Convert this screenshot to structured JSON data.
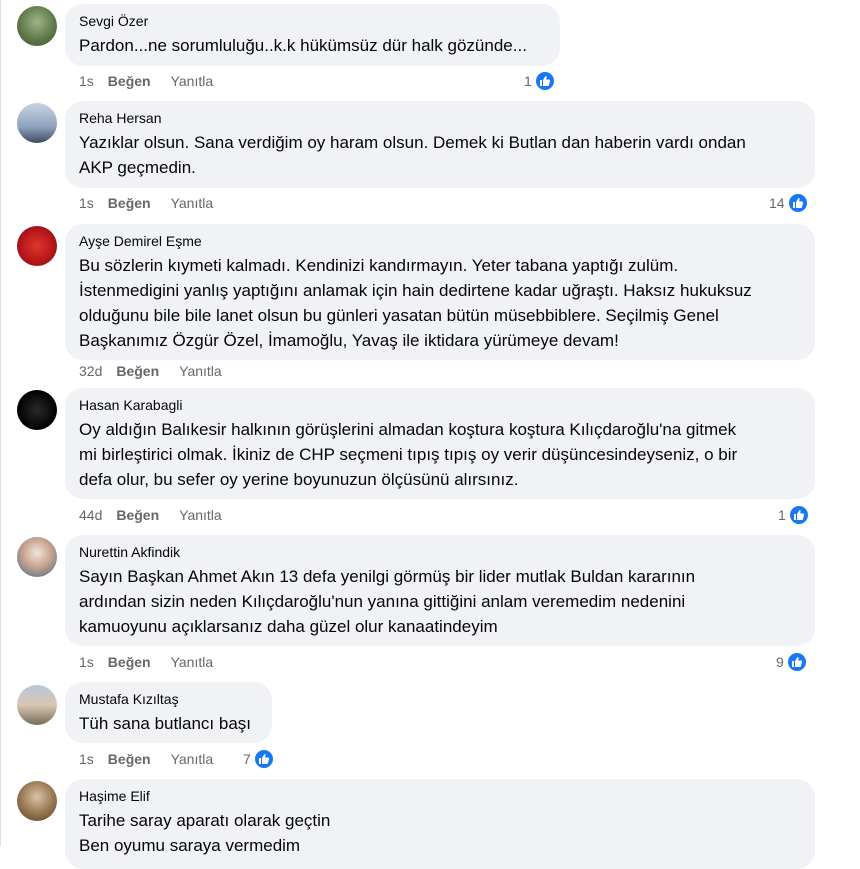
{
  "actions": {
    "like": "Beğen",
    "reply": "Yanıtla"
  },
  "colors": {
    "like_blue": "#1877f2",
    "bubble_bg": "#f0f2f5",
    "meta_gray": "#65676b"
  },
  "comments": [
    {
      "author": "Sevgi Özer",
      "text": "Pardon...ne sorumluluğu..k.k hükümsüz dür halk gözünde...",
      "time": "1s",
      "reactions": "1"
    },
    {
      "author": "Reha Hersan",
      "text": "Yazıklar olsun. Sana verdiğim oy haram olsun. Demek ki Butlan dan haberin vardı ondan\nAKP geçmedin.",
      "time": "1s",
      "reactions": "14"
    },
    {
      "author": "Ayşe Demirel Eşme",
      "text": "Bu sözlerin kıymeti kalmadı. Kendinizi kandırmayın. Yeter tabana yaptığı zulüm.\nİstenmedigini yanlış yaptığını anlamak için hain dedirtene kadar uğraştı. Haksız hukuksuz\nolduğunu bile bile lanet olsun bu günleri yasatan bütün müsebbiblere. Seçilmiş Genel\nBaşkanımız Özgür Özel, İmamoğlu, Yavaş ile iktidara yürümeye devam!",
      "time": "32d",
      "reactions": ""
    },
    {
      "author": "Hasan Karabagli",
      "text": "Oy aldığın Balıkesir halkının görüşlerini almadan koştura koştura Kılıçdaroğlu'na gitmek\nmi birleştirici olmak. İkiniz de CHP seçmeni tıpış tıpış oy verir düşüncesindeyseniz, o bir\ndefa olur, bu sefer oy yerine boyunuzun ölçüsünü alırsınız.",
      "time": "44d",
      "reactions": "1"
    },
    {
      "author": "Nurettin Akfindik",
      "text": "Sayın Başkan Ahmet Akın 13 defa yenilgi görmüş bir lider mutlak Buldan kararının\nardından sizin neden Kılıçdaroğlu'nun yanına gittiğini anlam veremedim nedenini\nkamuoyunu açıklarsanız daha güzel olur kanaatindeyim",
      "time": "1s",
      "reactions": "9"
    },
    {
      "author": "Mustafa Kızıltaş",
      "text": "Tüh sana butlancı başı",
      "time": "1s",
      "reactions": "7"
    },
    {
      "author": "Haşime Elif",
      "text": "Tarihe saray aparatı olarak geçtin\nBen oyumu saraya vermedim",
      "time": "",
      "reactions": ""
    }
  ]
}
